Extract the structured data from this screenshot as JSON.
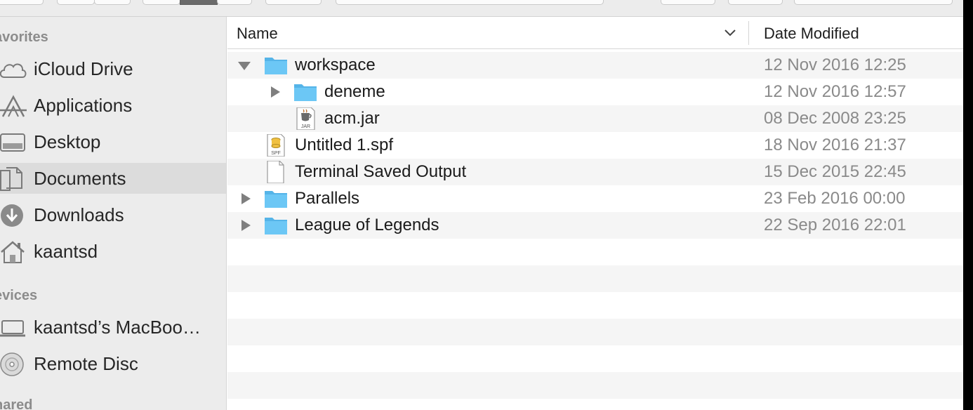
{
  "sidebar": {
    "sections": [
      {
        "label": "avorites"
      },
      {
        "label": "evices"
      },
      {
        "label": "hared"
      }
    ],
    "favorites": [
      {
        "label": "iCloud Drive",
        "icon": "cloud-icon"
      },
      {
        "label": "Applications",
        "icon": "applications-icon"
      },
      {
        "label": "Desktop",
        "icon": "desktop-icon"
      },
      {
        "label": "Documents",
        "icon": "documents-icon",
        "selected": true
      },
      {
        "label": "Downloads",
        "icon": "downloads-icon"
      },
      {
        "label": "kaantsd",
        "icon": "home-icon"
      }
    ],
    "devices": [
      {
        "label": "kaantsd’s MacBoo…",
        "icon": "laptop-icon"
      },
      {
        "label": "Remote Disc",
        "icon": "disc-icon"
      }
    ]
  },
  "columns": {
    "name": "Name",
    "date_modified": "Date Modified"
  },
  "files": [
    {
      "name": "workspace",
      "date": "12 Nov 2016 12:25",
      "kind": "folder",
      "expanded": true
    },
    {
      "name": "deneme",
      "date": "12 Nov 2016 12:57",
      "kind": "folder",
      "expanded": false
    },
    {
      "name": "acm.jar",
      "date": "08 Dec 2008 23:25",
      "kind": "jar"
    },
    {
      "name": "Untitled 1.spf",
      "date": "18 Nov 2016 21:37",
      "kind": "spf"
    },
    {
      "name": "Terminal Saved Output",
      "date": "15 Dec 2015 22:45",
      "kind": "document"
    },
    {
      "name": "Parallels",
      "date": "23 Feb 2016 00:00",
      "kind": "folder",
      "expanded": false
    },
    {
      "name": "League of Legends",
      "date": "22 Sep 2016 22:01",
      "kind": "folder",
      "expanded": false
    }
  ],
  "icon_labels": {
    "jar_badge": "JAR",
    "spf_badge": "SPF"
  },
  "colors": {
    "folder": "#6cc7f5",
    "folder_tab": "#55b4e8",
    "sidebar_bg": "#ececec",
    "row_alt": "#f5f5f5"
  }
}
